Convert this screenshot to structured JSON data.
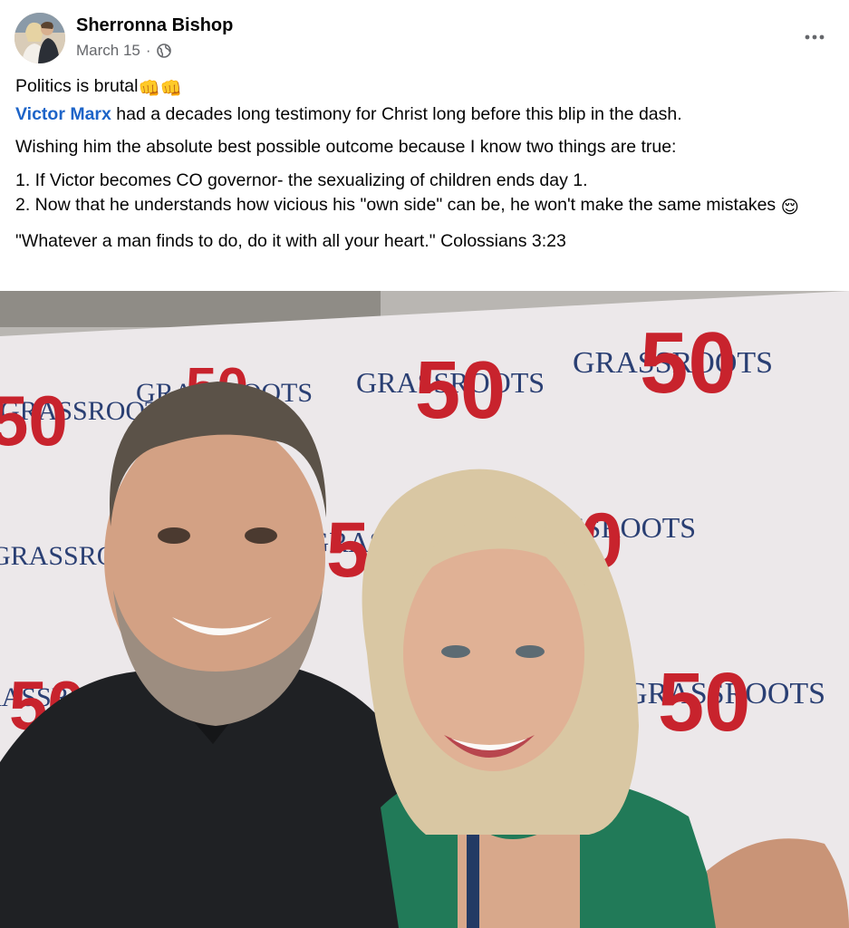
{
  "post": {
    "author": "Sherronna Bishop",
    "date": "March 15",
    "separator": "·",
    "privacy_icon": "globe-icon",
    "more_icon": "more-options-icon",
    "line1": "Politics is brutal",
    "line1_emoji": "👊👊",
    "mention": "Victor Marx",
    "line2_rest": " had a decades long testimony for Christ long before this blip in the dash.",
    "line3": "Wishing him the absolute best possible outcome because I know two things are true:",
    "item1": "1. If Victor becomes CO governor- the sexualizing of children ends day 1.",
    "item2": "2. Now that he understands how vicious his \"own side\" can be, he won't make the same mistakes",
    "item2_emoji": "😌",
    "quote": "\"Whatever a man finds to do, do it with all your heart.\" Colossians 3:23"
  },
  "photo": {
    "backdrop_word": "GRASSROOTS",
    "backdrop_number": "50",
    "colors": {
      "number_red": "#c8232d",
      "word_navy": "#2a3f73",
      "backdrop": "#ece8ea"
    }
  }
}
